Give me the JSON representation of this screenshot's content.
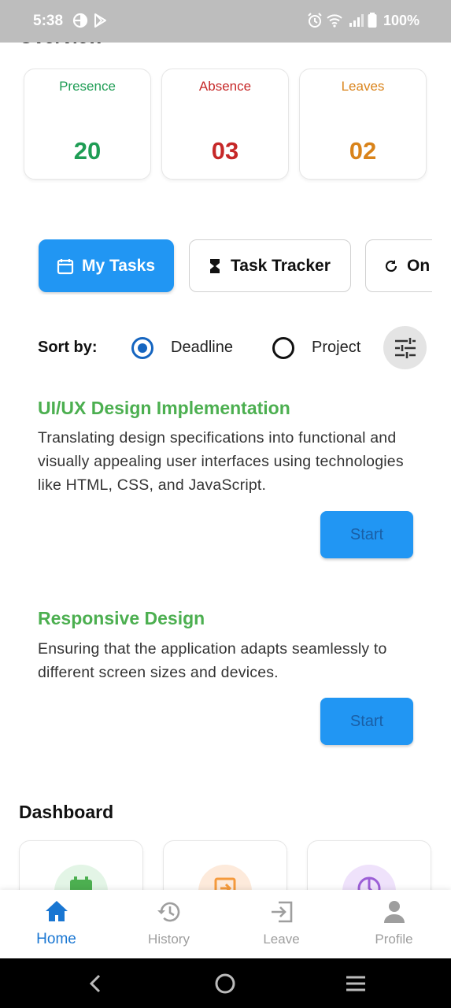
{
  "status_bar": {
    "time": "5:38",
    "battery": "100%"
  },
  "overview": {
    "title": "Overview",
    "cards": [
      {
        "label": "Presence",
        "value": "20",
        "color": "#1f9d55"
      },
      {
        "label": "Absence",
        "value": "03",
        "color": "#c62828"
      },
      {
        "label": "Leaves",
        "value": "02",
        "color": "#d9831a"
      }
    ]
  },
  "tabs": [
    {
      "label": "My Tasks",
      "icon": "calendar-icon",
      "active": true
    },
    {
      "label": "Task Tracker",
      "icon": "hourglass-icon",
      "active": false
    },
    {
      "label": "On",
      "icon": "refresh-icon",
      "active": false
    }
  ],
  "sort": {
    "label": "Sort by:",
    "options": [
      {
        "label": "Deadline",
        "checked": true
      },
      {
        "label": "Project",
        "checked": false
      }
    ],
    "filter_icon": "tune-icon"
  },
  "tasks": [
    {
      "title": "UI/UX Design Implementation",
      "description": "Translating design specifications into functional and visually appealing user interfaces using technologies like HTML, CSS, and JavaScript.",
      "button": "Start"
    },
    {
      "title": "Responsive Design",
      "description": "Ensuring that the application adapts seamlessly to different screen sizes and devices.",
      "button": "Start"
    }
  ],
  "dashboard": {
    "title": "Dashboard",
    "cards": [
      {
        "icon": "calendar-icon",
        "color": "#4caf50",
        "bg": "#e3f5e6"
      },
      {
        "icon": "leave-icon",
        "color": "#f59a3c",
        "bg": "#fdeadb"
      },
      {
        "icon": "pie-chart-icon",
        "color": "#9c5fd6",
        "bg": "#efe2fb"
      }
    ]
  },
  "bottom_nav": [
    {
      "label": "Home",
      "icon": "home-icon",
      "active": true
    },
    {
      "label": "History",
      "icon": "history-icon",
      "active": false
    },
    {
      "label": "Leave",
      "icon": "exit-icon",
      "active": false
    },
    {
      "label": "Profile",
      "icon": "person-icon",
      "active": false
    }
  ],
  "colors": {
    "accent": "#2196f3",
    "task_title": "#4caf50",
    "nav_active": "#1976d2"
  }
}
